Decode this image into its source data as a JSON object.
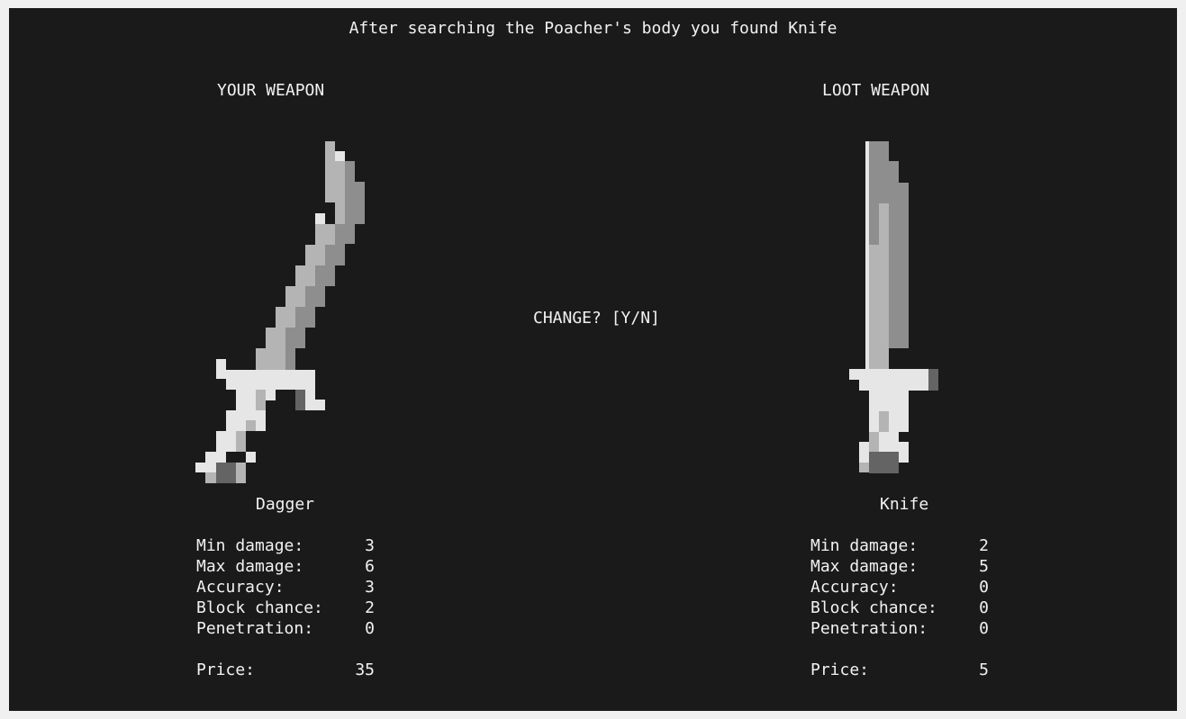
{
  "header": "After searching the Poacher's body you found Knife",
  "your_weapon": {
    "label": "YOUR WEAPON",
    "name": "Dagger",
    "icon": "dagger-sprite",
    "stats": [
      {
        "label": "Min damage:",
        "value": "3"
      },
      {
        "label": "Max damage:",
        "value": "6"
      },
      {
        "label": "Accuracy:",
        "value": "3"
      },
      {
        "label": "Block chance:",
        "value": "2"
      },
      {
        "label": "Penetration:",
        "value": "0"
      }
    ],
    "price": {
      "label": "Price:",
      "value": "35"
    }
  },
  "loot_weapon": {
    "label": "LOOT WEAPON",
    "name": "Knife",
    "icon": "knife-sprite",
    "stats": [
      {
        "label": "Min damage:",
        "value": "2"
      },
      {
        "label": "Max damage:",
        "value": "5"
      },
      {
        "label": "Accuracy:",
        "value": "0"
      },
      {
        "label": "Block chance:",
        "value": "0"
      },
      {
        "label": "Penetration:",
        "value": "0"
      }
    ],
    "price": {
      "label": "Price:",
      "value": "5"
    }
  },
  "prompt": "CHANGE? [Y/N]",
  "colors": {
    "background": "#1a1a1a",
    "text": "#f2f2f2",
    "pixel_light": "#e6e6e6",
    "pixel_mid": "#b4b4b4",
    "pixel_dark": "#8e8e8e",
    "pixel_shadow": "#646464"
  }
}
